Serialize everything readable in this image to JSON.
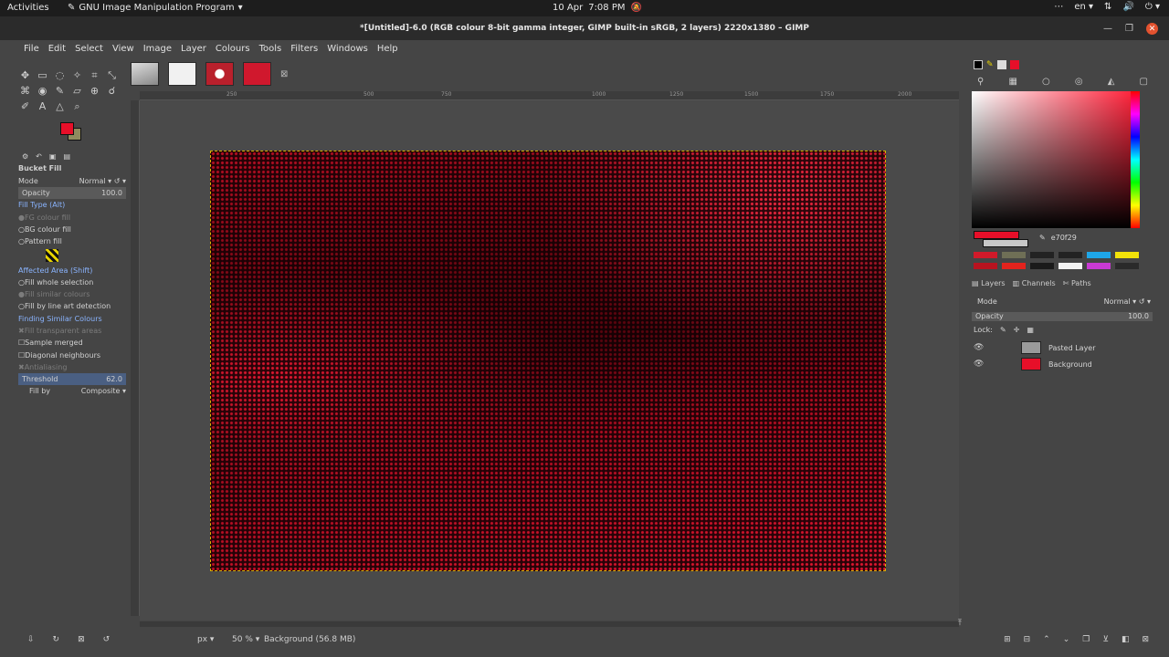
{
  "topbar": {
    "activities": "Activities",
    "app_name": "GNU Image Manipulation Program",
    "date": "10 Apr",
    "time": "7:08 PM",
    "lang": "en"
  },
  "window": {
    "title": "*[Untitled]-6.0 (RGB colour 8-bit gamma integer, GIMP built-in sRGB, 2 layers) 2220x1380 – GIMP"
  },
  "menu": [
    "File",
    "Edit",
    "Select",
    "View",
    "Image",
    "Layer",
    "Colours",
    "Tools",
    "Filters",
    "Windows",
    "Help"
  ],
  "tool_options": {
    "title": "Bucket Fill",
    "mode_label": "Mode",
    "mode_value": "Normal",
    "opacity_label": "Opacity",
    "opacity_value": "100.0",
    "fill_type_header": "Fill Type  (Alt)",
    "fg_fill": "FG colour fill",
    "bg_fill": "BG colour fill",
    "pattern_fill": "Pattern fill",
    "affected_header": "Affected Area  (Shift)",
    "fill_whole": "Fill whole selection",
    "fill_similar": "Fill similar colours",
    "fill_line_art": "Fill by line art detection",
    "finding_header": "Finding Similar Colours",
    "fill_transparent": "Fill transparent areas",
    "sample_merged": "Sample merged",
    "diagonal": "Diagonal neighbours",
    "antialiasing": "Antialiasing",
    "threshold_label": "Threshold",
    "threshold_value": "62.0",
    "fill_by_label": "Fill by",
    "fill_by_value": "Composite"
  },
  "rulers": {
    "h_ticks": [
      "250",
      "500",
      "750",
      "1000",
      "1250",
      "1500",
      "1750",
      "2000"
    ]
  },
  "status": {
    "unit": "px",
    "zoom": "50 %",
    "message": "Background (56.8 MB)"
  },
  "colors": {
    "fg": "#e70f29",
    "bg": "#8f8a5e",
    "hex_value": "e70f29"
  },
  "layers_panel": {
    "tab_layers": "Layers",
    "tab_channels": "Channels",
    "tab_paths": "Paths",
    "mode_label": "Mode",
    "mode_value": "Normal",
    "opacity_label": "Opacity",
    "opacity_value": "100.0",
    "lock_label": "Lock:",
    "layers": [
      {
        "name": "Pasted Layer",
        "thumb": "#9a9a9a"
      },
      {
        "name": "Background",
        "thumb": "#e70f29"
      }
    ]
  }
}
